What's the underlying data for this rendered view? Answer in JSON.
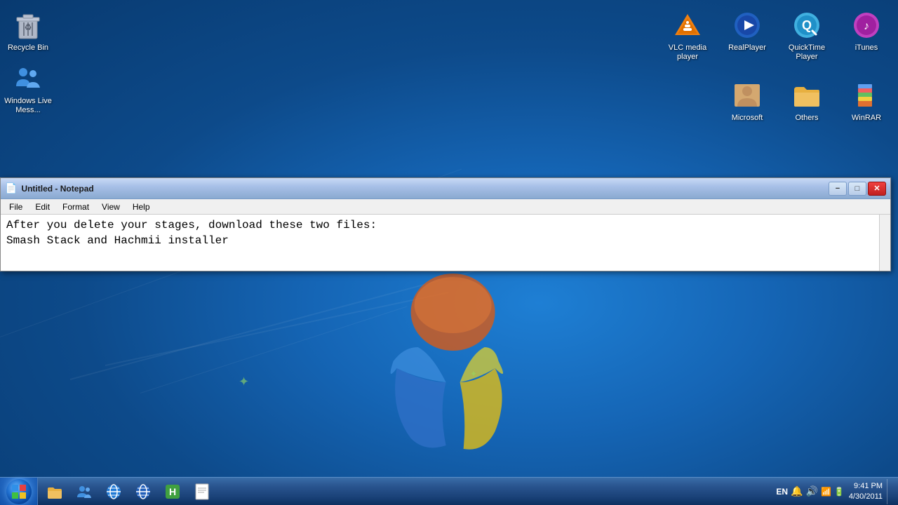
{
  "desktop": {
    "background_color": "#1565b5"
  },
  "desktop_icons_left": [
    {
      "id": "recycle-bin",
      "label": "Recycle Bin",
      "icon": "recycle"
    },
    {
      "id": "windows-live-messenger",
      "label": "Windows Live Mess...",
      "icon": "messenger"
    }
  ],
  "desktop_icons_right_top": [
    {
      "id": "vlc-media-player",
      "label": "VLC media player",
      "icon": "vlc"
    },
    {
      "id": "realplayer",
      "label": "RealPlayer",
      "icon": "realplayer"
    },
    {
      "id": "quicktime-player",
      "label": "QuickTime Player",
      "icon": "quicktime"
    },
    {
      "id": "itunes",
      "label": "iTunes",
      "icon": "itunes"
    }
  ],
  "desktop_icons_right_bottom": [
    {
      "id": "microsoft",
      "label": "Microsoft",
      "icon": "microsoft"
    },
    {
      "id": "others",
      "label": "Others",
      "icon": "others"
    },
    {
      "id": "winrar",
      "label": "WinRAR",
      "icon": "winrar"
    }
  ],
  "notepad": {
    "title": "Untitled - Notepad",
    "menu_items": [
      "File",
      "Edit",
      "Format",
      "View",
      "Help"
    ],
    "content": "After you delete your stages, download these two files:\nSmash Stack and Hachmii installer",
    "minimize_label": "−",
    "maximize_label": "□",
    "close_label": "✕"
  },
  "taskbar": {
    "start_button_icon": "⊞",
    "items": [
      {
        "id": "explorer",
        "icon": "📁"
      },
      {
        "id": "windows-live-messenger-task",
        "icon": "👥"
      },
      {
        "id": "ie",
        "icon": "🌐"
      },
      {
        "id": "ie2",
        "icon": "🌐"
      },
      {
        "id": "hackmii",
        "icon": "📗"
      },
      {
        "id": "notepad-task",
        "icon": "📄"
      }
    ],
    "clock": {
      "time": "9:41 PM",
      "date": "4/30/2011"
    },
    "lang": "EN",
    "system_icons": [
      "🔊",
      "📶"
    ]
  }
}
